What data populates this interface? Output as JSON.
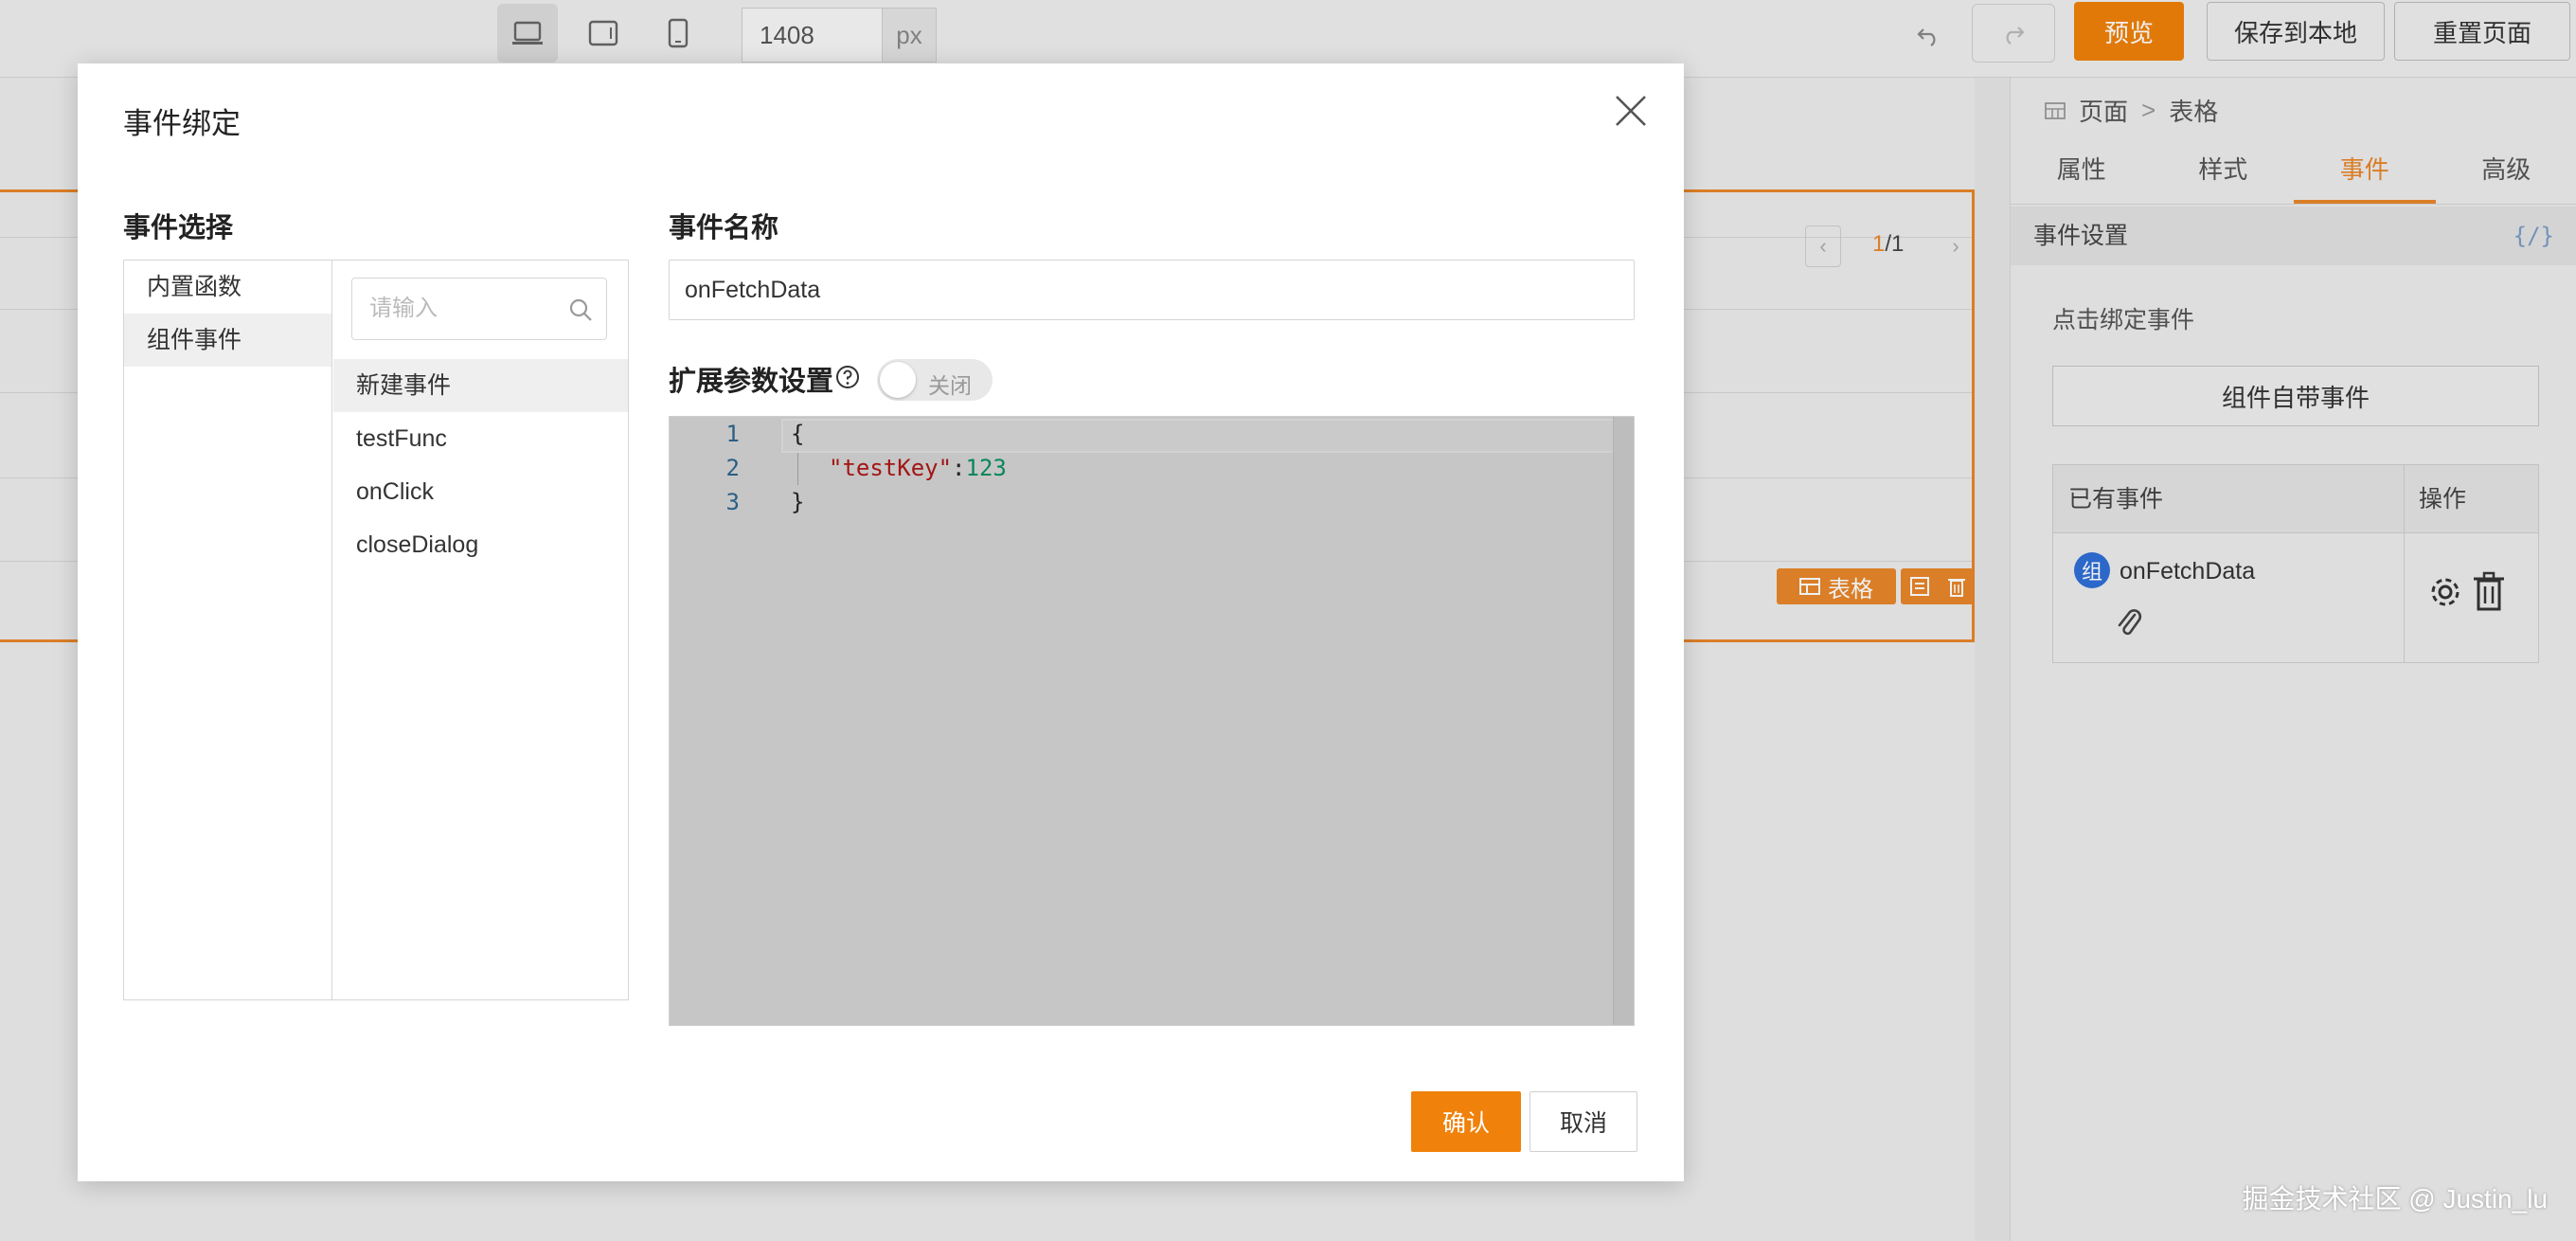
{
  "toolbar": {
    "width_value": "1408",
    "width_unit": "px",
    "preview_label": "预览",
    "save_local_label": "保存到本地",
    "reset_label": "重置页面",
    "accent_color": "#f0810a"
  },
  "canvas": {
    "pager_current": "1",
    "pager_total": "/1",
    "component_tag": "表格"
  },
  "right_panel": {
    "breadcrumb": [
      "页面",
      "表格"
    ],
    "tabs": [
      {
        "label": "属性",
        "active": false
      },
      {
        "label": "样式",
        "active": false
      },
      {
        "label": "事件",
        "active": true
      },
      {
        "label": "高级",
        "active": false
      }
    ],
    "section_title": "事件设置",
    "section_code_icon": "{/}",
    "bind_label": "点击绑定事件",
    "builtin_button": "组件自带事件",
    "table_headers": [
      "已有事件",
      "操作"
    ],
    "events": [
      {
        "badge": "组",
        "name": "onFetchData"
      }
    ]
  },
  "modal": {
    "title": "事件绑定",
    "select_title": "事件选择",
    "name_title": "事件名称",
    "categories": [
      {
        "label": "内置函数",
        "selected": false
      },
      {
        "label": "组件事件",
        "selected": true
      }
    ],
    "search_placeholder": "请输入",
    "event_list": [
      {
        "label": "新建事件",
        "selected": true
      },
      {
        "label": "testFunc",
        "selected": false
      },
      {
        "label": "onClick",
        "selected": false
      },
      {
        "label": "closeDialog",
        "selected": false
      }
    ],
    "event_name_value": "onFetchData",
    "ext_params_label": "扩展参数设置",
    "toggle_label": "关闭",
    "toggle_on": false,
    "code_lines": [
      {
        "num": "1",
        "text": "{"
      },
      {
        "num": "2",
        "key": "\"testKey\"",
        "sep": ":",
        "value": "123"
      },
      {
        "num": "3",
        "text": "}"
      }
    ],
    "confirm_label": "确认",
    "cancel_label": "取消"
  },
  "watermark": "掘金技术社区 @ Justin_lu"
}
